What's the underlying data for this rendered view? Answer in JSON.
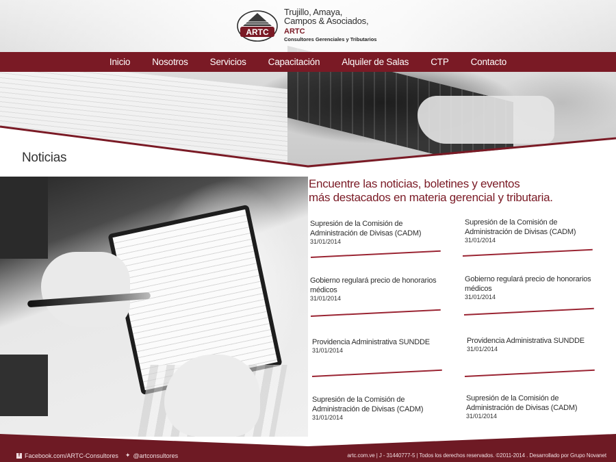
{
  "brand": {
    "logo_text": "ARTC",
    "name_line1": "Trujillo, Amaya,",
    "name_line2": "Campos & Asociados,",
    "short": "ARTC",
    "tagline": "Consultores Gerenciales y Tributarios",
    "color": "#7a1a25"
  },
  "nav": {
    "items": [
      "Inicio",
      "Nosotros",
      "Servicios",
      "Capacitación",
      "Alquiler de Salas",
      "CTP",
      "Contacto"
    ]
  },
  "page": {
    "section_title": "Noticias",
    "intro_line1": "Encuentre las noticias, boletines y eventos",
    "intro_line2": "más destacados en materia gerencial y tributaria."
  },
  "news": [
    {
      "title": "Supresión de la Comisión de Administración de Divisas (CADM)",
      "date": "31/01/2014"
    },
    {
      "title": "Supresión de la Comisión de Administración de Divisas (CADM)",
      "date": "31/01/2014"
    },
    {
      "title": "Gobierno regulará precio de honorarios médicos",
      "date": "31/01/2014"
    },
    {
      "title": "Gobierno regulará precio de honorarios médicos",
      "date": "31/01/2014"
    },
    {
      "title": "Providencia Administrativa SUNDDE",
      "date": "31/01/2014"
    },
    {
      "title": "Providencia Administrativa SUNDDE",
      "date": "31/01/2014"
    },
    {
      "title": "Supresión de la Comisión de Administración de Divisas (CADM)",
      "date": "31/01/2014"
    },
    {
      "title": "Supresión de la Comisión de Administración de Divisas (CADM)",
      "date": "31/01/2014"
    }
  ],
  "footer": {
    "facebook_icon": "facebook-icon",
    "facebook": "Facebook.com/ARTC-Consultores",
    "twitter_icon": "twitter-icon",
    "twitter": "@artconsultores",
    "right": "artc.com.ve | J - 31440777-5 | Todos los derechos reservados. ©2011-2014 . Desarrollado por  Grupo Novanet"
  }
}
